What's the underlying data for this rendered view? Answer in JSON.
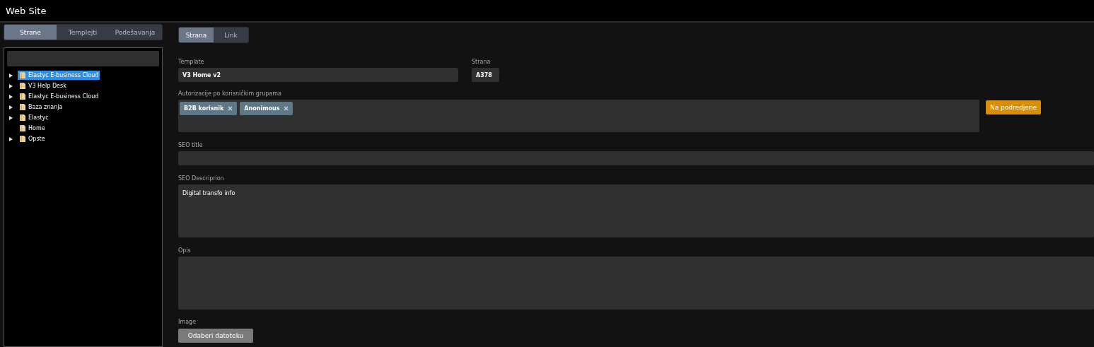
{
  "window": {
    "title": "Web Site"
  },
  "sidebar": {
    "tabs": [
      {
        "label": "Strane",
        "selected": true
      },
      {
        "label": "Templejti",
        "selected": false
      },
      {
        "label": "Podešavanja",
        "selected": false
      }
    ],
    "tree": [
      {
        "label": "Elastyc E-business Cloud",
        "expandable": true,
        "selected": true
      },
      {
        "label": "V3 Help Desk",
        "expandable": true,
        "selected": false
      },
      {
        "label": "Elastyc E-business Cloud",
        "expandable": true,
        "selected": false
      },
      {
        "label": "Baza znanja",
        "expandable": true,
        "selected": false
      },
      {
        "label": "Elastyc",
        "expandable": true,
        "selected": false
      },
      {
        "label": "Home",
        "expandable": false,
        "selected": false
      },
      {
        "label": "Opste",
        "expandable": true,
        "selected": false
      }
    ]
  },
  "form": {
    "tabs": [
      {
        "label": "Strana",
        "selected": true
      },
      {
        "label": "Link",
        "selected": false
      }
    ],
    "template": {
      "label": "Template",
      "value": "V3 Home v2"
    },
    "strana": {
      "label": "Strana",
      "value": "A378"
    },
    "authorization": {
      "label": "Autorizacije po korisničkim grupama",
      "tags": [
        "B2B korisnik",
        "Anonimous"
      ],
      "button": "Na podredjene"
    },
    "seo_title": {
      "label": "SEO title"
    },
    "seo_description": {
      "label": "SEO Descriprion",
      "value": "Digital transfo info"
    },
    "opis": {
      "label": "Opis"
    },
    "image": {
      "label": "Image",
      "button": "Odaberi datoteku"
    }
  }
}
